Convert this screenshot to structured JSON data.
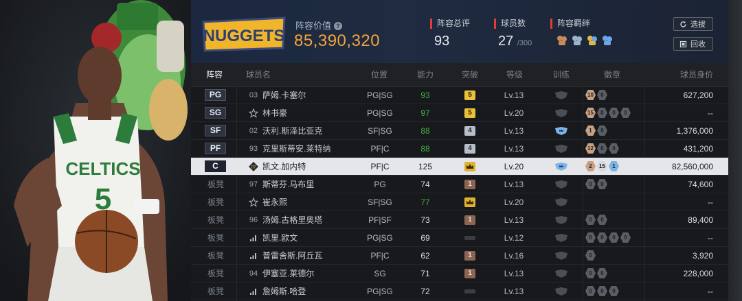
{
  "team": {
    "name": "NUGGETS",
    "lineup_value_label": "阵容价值",
    "lineup_value": "85,390,320"
  },
  "stats": {
    "overall_label": "阵容总评",
    "overall_value": "93",
    "player_count_label": "球员数",
    "player_count": "27",
    "player_count_max": "/300",
    "bonds_label": "阵容羁绊",
    "bond_icons": [
      "bond-red-icon",
      "bond-blue-icon",
      "bond-gold-icon",
      "bond-lightblue-icon"
    ]
  },
  "buttons": {
    "select_label": "选拔",
    "recycle_label": "回收"
  },
  "columns": [
    "阵容",
    "球员名",
    "位置",
    "能力",
    "突破",
    "等级",
    "训练",
    "徽章",
    "球员身价"
  ],
  "colors": {
    "accent_orange": "#f4a23c",
    "rating_green": "#3fae49",
    "red_marker": "#e13b3b"
  },
  "players": [
    {
      "slot": "PG",
      "bench": false,
      "number": "03",
      "icon": "",
      "name": "萨姆.卡塞尔",
      "position": "PG|SG",
      "rating": "93",
      "rating_color": "green",
      "breakthrough": "5",
      "brk_style": "gold",
      "level": "Lv.13",
      "training": "gray",
      "badges": [
        {
          "c": "bronze",
          "t": "10"
        },
        {
          "c": "gray",
          "t": "0"
        }
      ],
      "value": "627,200",
      "selected": false
    },
    {
      "slot": "SG",
      "bench": false,
      "number": "",
      "icon": "star",
      "name": "林书豪",
      "position": "PG|SG",
      "rating": "97",
      "rating_color": "green",
      "breakthrough": "5",
      "brk_style": "gold",
      "level": "Lv.20",
      "training": "gray",
      "badges": [
        {
          "c": "bronze",
          "t": "15"
        },
        {
          "c": "gray",
          "t": "0"
        },
        {
          "c": "gray",
          "t": "0"
        },
        {
          "c": "gray",
          "t": "0"
        }
      ],
      "value": "--",
      "selected": false
    },
    {
      "slot": "SF",
      "bench": false,
      "number": "02",
      "icon": "",
      "name": "沃利.斯泽比亚克",
      "position": "SF|SG",
      "rating": "88",
      "rating_color": "green",
      "breakthrough": "4",
      "brk_style": "silver",
      "level": "Lv.13",
      "training": "blue",
      "badges": [
        {
          "c": "bronze",
          "t": "1"
        },
        {
          "c": "gray",
          "t": "0"
        }
      ],
      "value": "1,376,000",
      "selected": false
    },
    {
      "slot": "PF",
      "bench": false,
      "number": "93",
      "icon": "",
      "name": "克里斯蒂安.莱特纳",
      "position": "PF|C",
      "rating": "88",
      "rating_color": "green",
      "breakthrough": "4",
      "brk_style": "silver",
      "level": "Lv.13",
      "training": "gray",
      "badges": [
        {
          "c": "bronze",
          "t": "12"
        },
        {
          "c": "gray",
          "t": "0"
        },
        {
          "c": "gray",
          "t": "0"
        }
      ],
      "value": "431,200",
      "selected": false
    },
    {
      "slot": "C",
      "bench": false,
      "number": "",
      "icon": "diamond",
      "name": "凯文.加内特",
      "position": "PF|C",
      "rating": "125",
      "rating_color": "dark",
      "breakthrough": "crown",
      "brk_style": "crown",
      "level": "Lv.20",
      "training": "blue",
      "badges": [
        {
          "c": "bronze",
          "t": "2"
        },
        {
          "c": "silver",
          "t": "15"
        },
        {
          "c": "blue",
          "t": "1"
        }
      ],
      "value": "82,560,000",
      "selected": true
    },
    {
      "slot": "板凳",
      "bench": true,
      "number": "97",
      "icon": "",
      "name": "斯蒂芬.马布里",
      "position": "PG",
      "rating": "74",
      "rating_color": "white",
      "breakthrough": "1",
      "brk_style": "bronze",
      "level": "Lv.13",
      "training": "gray",
      "badges": [
        {
          "c": "gray",
          "t": "0"
        },
        {
          "c": "gray",
          "t": "0"
        }
      ],
      "value": "74,600",
      "selected": false
    },
    {
      "slot": "板凳",
      "bench": true,
      "number": "",
      "icon": "star",
      "name": "崔永熙",
      "position": "SF|SG",
      "rating": "77",
      "rating_color": "green",
      "breakthrough": "crown",
      "brk_style": "crown",
      "level": "Lv.20",
      "training": "gray",
      "badges": [],
      "value": "--",
      "selected": false
    },
    {
      "slot": "板凳",
      "bench": true,
      "number": "96",
      "icon": "",
      "name": "汤姆.古格里奥塔",
      "position": "PF|SF",
      "rating": "73",
      "rating_color": "white",
      "breakthrough": "1",
      "brk_style": "bronze",
      "level": "Lv.13",
      "training": "gray",
      "badges": [
        {
          "c": "gray",
          "t": "0"
        },
        {
          "c": "gray",
          "t": "0"
        }
      ],
      "value": "89,400",
      "selected": false
    },
    {
      "slot": "板凳",
      "bench": true,
      "number": "",
      "icon": "bars",
      "name": "凯里.欧文",
      "position": "PG|SG",
      "rating": "69",
      "rating_color": "white",
      "breakthrough": "",
      "brk_style": "none",
      "level": "Lv.12",
      "training": "gray",
      "badges": [
        {
          "c": "gray",
          "t": "0"
        },
        {
          "c": "gray",
          "t": "0"
        },
        {
          "c": "gray",
          "t": "0"
        },
        {
          "c": "gray",
          "t": "0"
        }
      ],
      "value": "--",
      "selected": false
    },
    {
      "slot": "板凳",
      "bench": true,
      "number": "",
      "icon": "bars",
      "name": "普雷舍斯.阿丘瓦",
      "position": "PF|C",
      "rating": "62",
      "rating_color": "white",
      "breakthrough": "1",
      "brk_style": "bronze",
      "level": "Lv.16",
      "training": "gray",
      "badges": [
        {
          "c": "gray",
          "t": "0"
        }
      ],
      "value": "3,920",
      "selected": false
    },
    {
      "slot": "板凳",
      "bench": true,
      "number": "94",
      "icon": "",
      "name": "伊塞亚.莱德尔",
      "position": "SG",
      "rating": "71",
      "rating_color": "white",
      "breakthrough": "1",
      "brk_style": "bronze",
      "level": "Lv.13",
      "training": "gray",
      "badges": [
        {
          "c": "gray",
          "t": "0"
        },
        {
          "c": "gray",
          "t": "0"
        }
      ],
      "value": "228,000",
      "selected": false
    },
    {
      "slot": "板凳",
      "bench": true,
      "number": "",
      "icon": "bars",
      "name": "詹姆斯.哈登",
      "position": "PG|SG",
      "rating": "72",
      "rating_color": "white",
      "breakthrough": "",
      "brk_style": "none",
      "level": "Lv.13",
      "training": "gray",
      "badges": [
        {
          "c": "gray",
          "t": "0"
        },
        {
          "c": "gray",
          "t": "0"
        },
        {
          "c": "gray",
          "t": "0"
        }
      ],
      "value": "--",
      "selected": false
    }
  ],
  "hero": {
    "jersey_team": "CELTICS",
    "jersey_number": "5"
  }
}
